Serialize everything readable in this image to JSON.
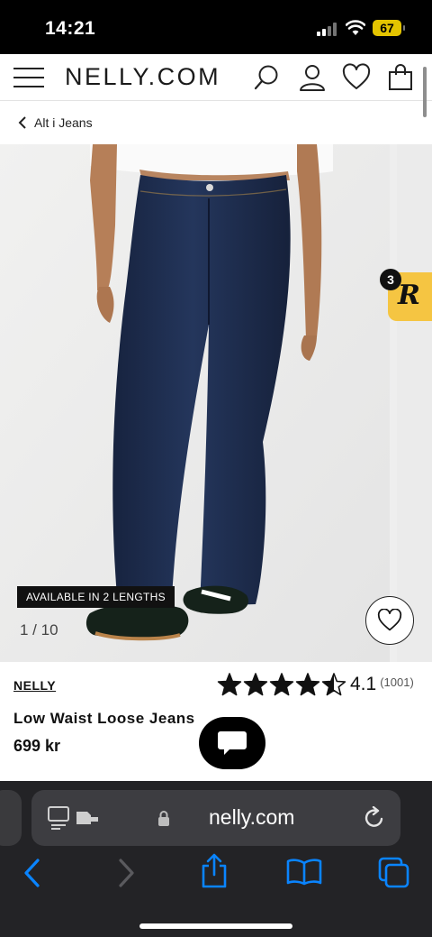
{
  "status_bar": {
    "time": "14:21",
    "battery": "67"
  },
  "header": {
    "logo": "NELLY.COM",
    "icons": [
      "menu-icon",
      "search-icon",
      "account-icon",
      "wishlist-icon",
      "bag-icon"
    ]
  },
  "breadcrumb": {
    "back_label": "Alt i Jeans"
  },
  "gallery": {
    "badge": "AVAILABLE IN 2 LENGTHS",
    "counter": "1 / 10",
    "widget_badge": "3",
    "widget_letter": "R"
  },
  "product": {
    "brand": "NELLY",
    "name": "Low Waist Loose Jeans",
    "price": "699 kr",
    "rating": {
      "value": "4.1",
      "count": "(1001)",
      "stars": 4.1
    }
  },
  "browser": {
    "url": "nelly.com"
  },
  "colors": {
    "widget_yellow": "#f5c542",
    "denim": "#1e2d4e",
    "toolbar_bg": "#232326",
    "toolbar_accent": "#0a84ff"
  }
}
